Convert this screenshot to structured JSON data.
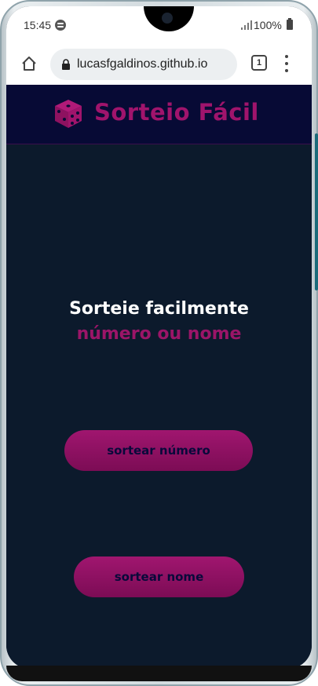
{
  "status_bar": {
    "time": "15:45",
    "battery": "100%"
  },
  "browser": {
    "url": "lucasfgaldinos.github.io",
    "tab_count": "1"
  },
  "site": {
    "title": "Sorteio Fácil",
    "brand_color": "#a0146c",
    "background_color": "#0c1a2c",
    "header_color": "#070a35"
  },
  "hero": {
    "line1": "Sorteie facilmente",
    "line2": "número ou nome"
  },
  "actions": {
    "draw_number": "sortear número",
    "draw_name": "sortear nome"
  },
  "icons": {
    "home": "home-icon",
    "lock": "lock-icon",
    "tabs": "tabs-icon",
    "menu": "kebab-menu-icon",
    "logo": "dice-icon"
  }
}
